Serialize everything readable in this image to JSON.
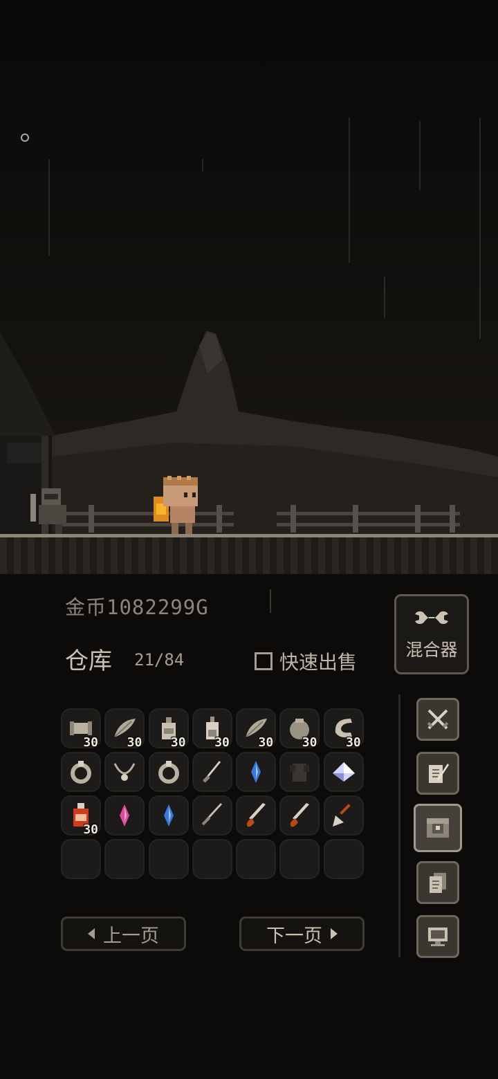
{
  "hud": {
    "gold_label": "金币1082299G"
  },
  "storage": {
    "title": "仓库",
    "count": "21/84",
    "quick_sell_label": "快速出售",
    "mixer_label": "混合器"
  },
  "pager": {
    "prev_label": "上一页",
    "next_label": "下一页"
  },
  "inventory": [
    {
      "icon": "scroll-icon",
      "qty": "30"
    },
    {
      "icon": "feather-icon",
      "qty": "30"
    },
    {
      "icon": "bottle-icon",
      "qty": "30"
    },
    {
      "icon": "potion-bottle-icon",
      "qty": "30"
    },
    {
      "icon": "feather-icon",
      "qty": "30"
    },
    {
      "icon": "stone-orb-icon",
      "qty": "30"
    },
    {
      "icon": "horn-icon",
      "qty": "30"
    },
    {
      "icon": "ring-icon",
      "qty": ""
    },
    {
      "icon": "necklace-icon",
      "qty": ""
    },
    {
      "icon": "ring-icon",
      "qty": ""
    },
    {
      "icon": "dagger-icon",
      "qty": ""
    },
    {
      "icon": "blue-crystal-icon",
      "qty": ""
    },
    {
      "icon": "dark-armor-icon",
      "qty": ""
    },
    {
      "icon": "diamond-gem-icon",
      "qty": ""
    },
    {
      "icon": "red-potion-icon",
      "qty": "30"
    },
    {
      "icon": "pink-crystal-icon",
      "qty": ""
    },
    {
      "icon": "blue-crystal-icon",
      "qty": ""
    },
    {
      "icon": "sword-icon",
      "qty": ""
    },
    {
      "icon": "saw-blade-icon",
      "qty": ""
    },
    {
      "icon": "saw-blade-icon",
      "qty": ""
    },
    {
      "icon": "shovel-icon",
      "qty": ""
    }
  ],
  "side_menu": [
    {
      "name": "equipment-button",
      "icon": "crossed-swords-icon"
    },
    {
      "name": "quest-button",
      "icon": "quill-paper-icon"
    },
    {
      "name": "storage-button",
      "icon": "chest-icon",
      "active": true
    },
    {
      "name": "records-button",
      "icon": "documents-icon"
    },
    {
      "name": "settings-button",
      "icon": "computer-icon"
    }
  ],
  "colors": {
    "accent_bg": "#0c0b09",
    "slot_bg": "#1c1b19",
    "button_bg": "#3a3731",
    "text": "#bdb6a8"
  }
}
